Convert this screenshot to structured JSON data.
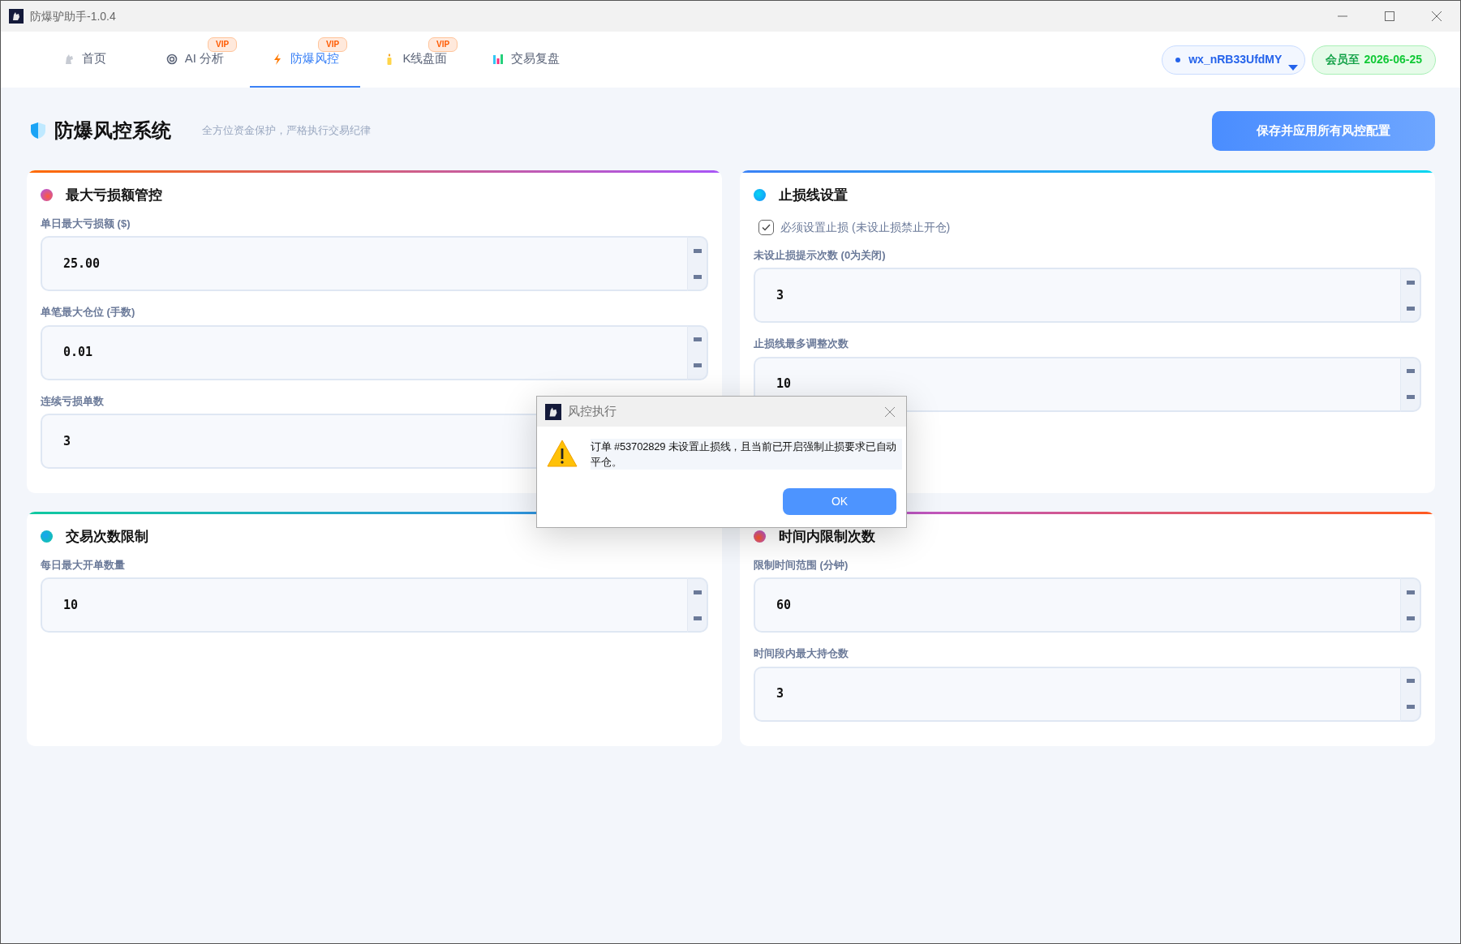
{
  "window": {
    "title": "防爆驴助手-1.0.4"
  },
  "tabs": [
    {
      "label": "首页",
      "selected": false
    },
    {
      "label": "AI 分析",
      "badge": "VIP",
      "selected": false
    },
    {
      "label": "防爆风控",
      "badge": "VIP",
      "selected": true
    },
    {
      "label": "K线盘面",
      "badge": "VIP",
      "selected": false
    },
    {
      "label": "交易复盘",
      "selected": false
    }
  ],
  "account": {
    "user": "wx_nRB33UfdMY",
    "membership_label": "会员至",
    "membership_date": "2026-06-25"
  },
  "header": {
    "title": "防爆风控系统",
    "subtitle": "全方位资金保护，严格执行交易纪律",
    "save_button": "保存并应用所有风控配置"
  },
  "cards": [
    {
      "title": "最大亏损额管控",
      "fields": [
        {
          "kind": "number",
          "label": "单日最大亏损额 ($)",
          "value": "25.00"
        },
        {
          "kind": "number",
          "label": "单笔最大仓位 (手数)",
          "value": "0.01"
        },
        {
          "kind": "number",
          "label": "连续亏损单数",
          "value": "3"
        }
      ]
    },
    {
      "title": "止损线设置",
      "fields": [
        {
          "kind": "checkbox",
          "label": "必须设置止损 (未设止损禁止开仓)",
          "checked": true
        },
        {
          "kind": "number",
          "label": "未设止损提示次数 (0为关闭)",
          "value": "3"
        },
        {
          "kind": "number",
          "label": "止损线最多调整次数",
          "value": "10"
        }
      ]
    },
    {
      "title": "交易次数限制",
      "fields": [
        {
          "kind": "number",
          "label": "每日最大开单数量",
          "value": "10"
        }
      ]
    },
    {
      "title": "时间内限制次数",
      "fields": [
        {
          "kind": "number",
          "label": "限制时间范围 (分钟)",
          "value": "60"
        },
        {
          "kind": "number",
          "label": "时间段内最大持仓数",
          "value": "3"
        }
      ]
    }
  ],
  "dialog": {
    "title": "风控执行",
    "message": "订单 #53702829 未设置止损线，且当前已开启强制止损要求已自动平仓。",
    "ok_button": "OK"
  }
}
